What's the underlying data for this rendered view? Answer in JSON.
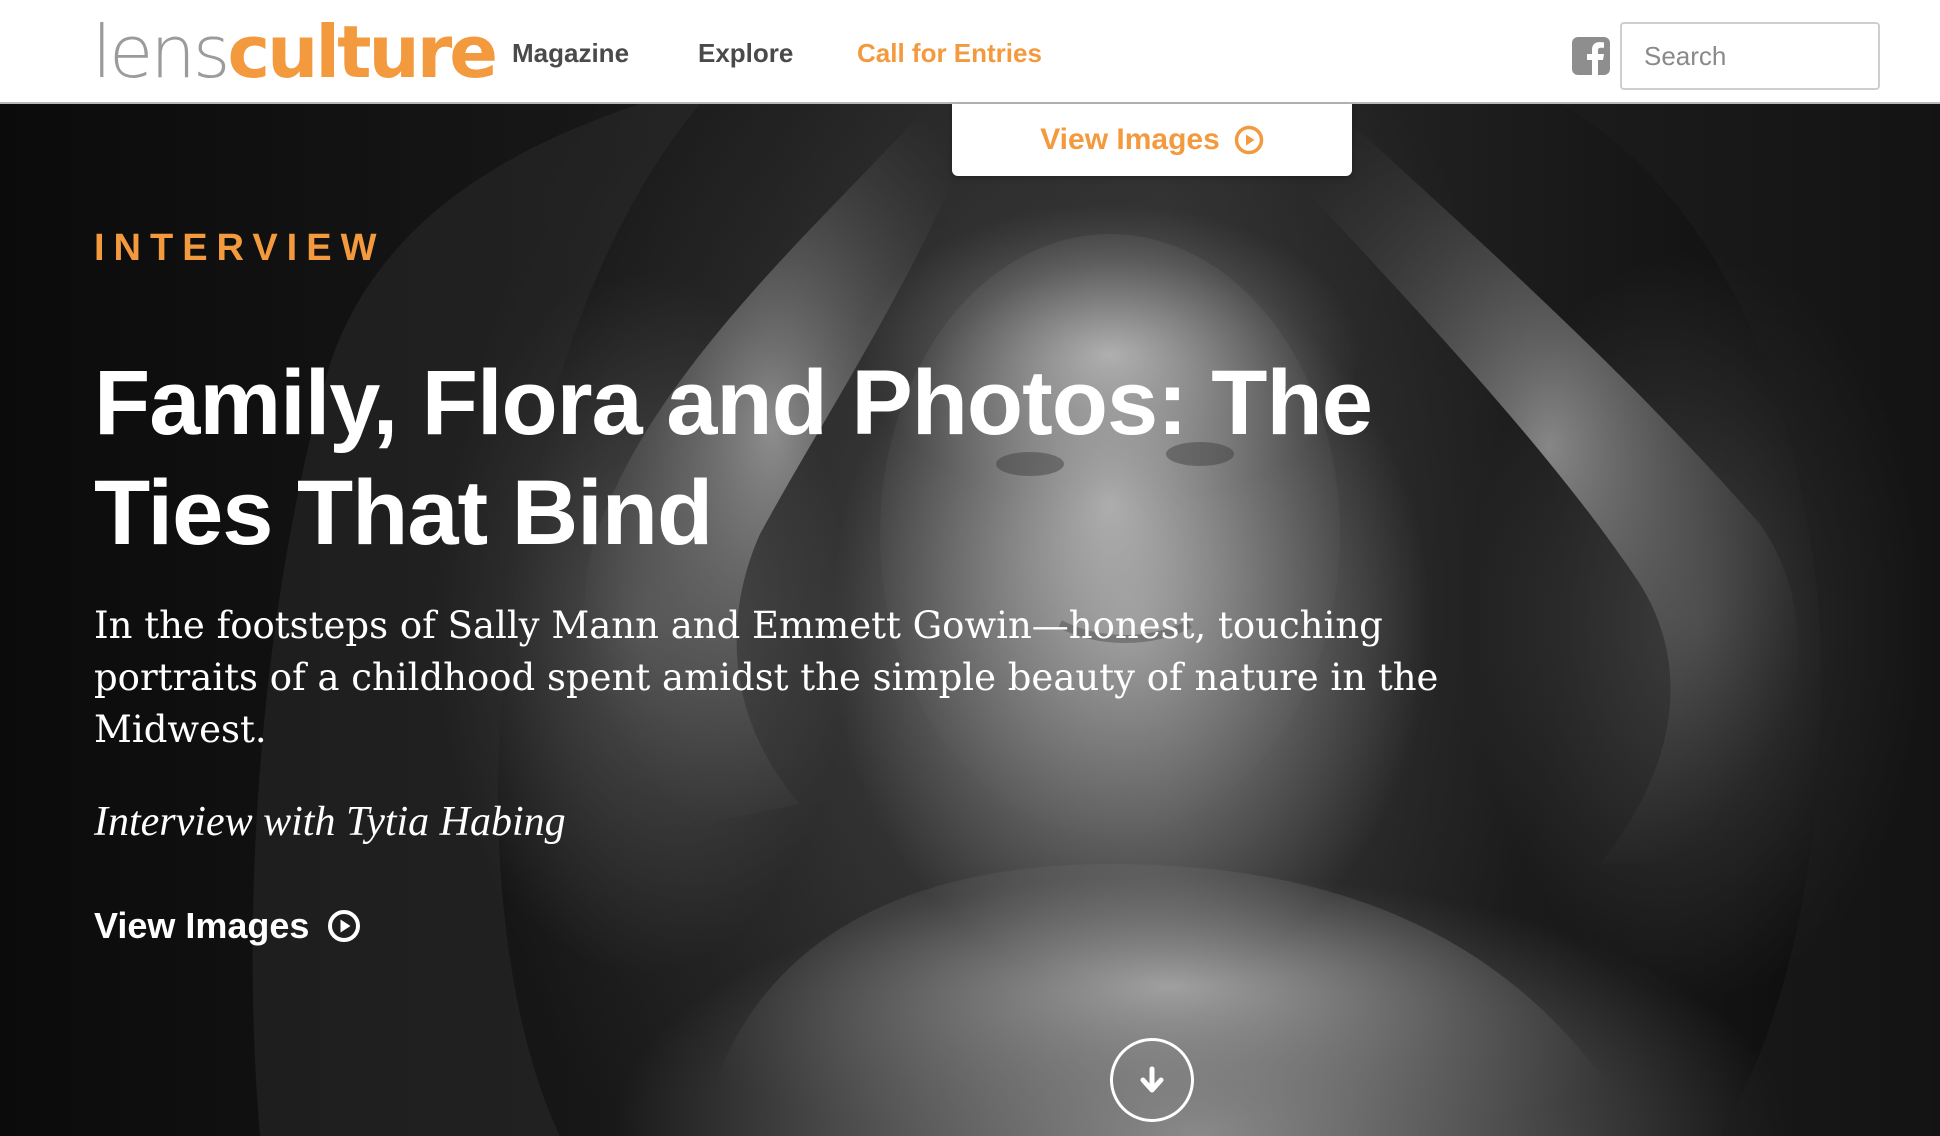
{
  "brand": {
    "logo_part1": "lens",
    "logo_part2": "culture",
    "accent_color": "#f39a3f"
  },
  "nav": {
    "items": [
      {
        "label": "Magazine"
      },
      {
        "label": "Explore"
      },
      {
        "label": "Call for Entries"
      }
    ],
    "facebook_icon": "facebook-icon",
    "search": {
      "placeholder": "Search",
      "value": ""
    }
  },
  "view_images_tab": {
    "label": "View Images",
    "icon": "play-circle-icon"
  },
  "hero": {
    "kicker": "INTERVIEW",
    "title": "Family, Flora and Photos: The Ties That Bind",
    "dek": "In the footsteps of Sally Mann and Emmett Gowin—honest, touching portraits of a childhood spent amidst the simple beauty of nature in the Midwest.",
    "byline": "Interview with Tytia Habing",
    "cta_label": "View Images",
    "cta_icon": "play-circle-icon",
    "scroll_icon": "arrow-down-icon"
  }
}
